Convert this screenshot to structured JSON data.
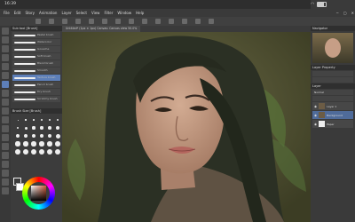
{
  "status": {
    "time": "16:39"
  },
  "menu": [
    "File",
    "Edit",
    "Story",
    "Animation",
    "Layer",
    "Select",
    "View",
    "Filter",
    "Window",
    "Help"
  ],
  "document": {
    "tab_label": "Untitled* (1px × 1px) Canvas: Canvas view 50.0%"
  },
  "subtool": {
    "header": "Sub tool [Brush]",
    "brushes": [
      "Pastel brush",
      "Watercolor",
      "Gouache",
      "Soft brush",
      "Blend brush",
      "Smooth watercolor",
      "Texture brush",
      "Pencil brush",
      "Dry brush",
      "Scratchy brush"
    ]
  },
  "brush_size": {
    "header": "Brush Size [Brush]"
  },
  "colors": {
    "accent": "#5d7fb9",
    "canvas_bg": "#4b4b2e"
  },
  "right_panel": {
    "navigator_header": "Navigator",
    "layer_property_header": "Layer Property",
    "layer_header": "Layer",
    "blend_mode": "Normal",
    "layers": [
      "Paper",
      "Background",
      "Layer 1"
    ]
  }
}
